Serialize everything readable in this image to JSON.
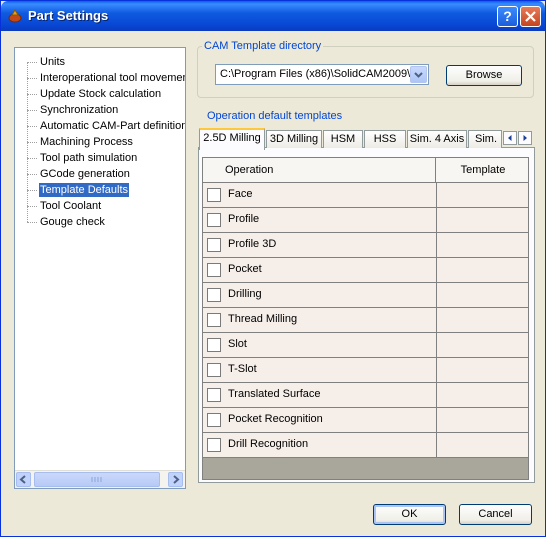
{
  "window": {
    "title": "Part Settings",
    "help_label": "?"
  },
  "tree": {
    "items": [
      {
        "label": "Units",
        "selected": false
      },
      {
        "label": "Interoperational tool movemen",
        "selected": false
      },
      {
        "label": "Update Stock calculation",
        "selected": false
      },
      {
        "label": "Synchronization",
        "selected": false
      },
      {
        "label": "Automatic CAM-Part definition",
        "selected": false
      },
      {
        "label": "Machining Process",
        "selected": false
      },
      {
        "label": "Tool path simulation",
        "selected": false
      },
      {
        "label": "GCode generation",
        "selected": false
      },
      {
        "label": "Template Defaults",
        "selected": true
      },
      {
        "label": "Tool Coolant",
        "selected": false
      },
      {
        "label": "Gouge check",
        "selected": false
      }
    ]
  },
  "cam_dir": {
    "group_title": "CAM Template directory",
    "path_value": "C:\\Program Files (x86)\\SolidCAM2009\\",
    "browse_label": "Browse"
  },
  "op_templates": {
    "group_title": "Operation default templates",
    "tabs": [
      "2.5D Milling",
      "3D Milling",
      "HSM",
      "HSS",
      "Sim. 4 Axis",
      "Sim."
    ],
    "active_tab": "2.5D Milling",
    "columns": {
      "operation": "Operation",
      "template": "Template"
    },
    "rows": [
      {
        "operation": "Face",
        "template": "",
        "checked": false
      },
      {
        "operation": "Profile",
        "template": "",
        "checked": false
      },
      {
        "operation": "Profile 3D",
        "template": "",
        "checked": false
      },
      {
        "operation": "Pocket",
        "template": "",
        "checked": false
      },
      {
        "operation": "Drilling",
        "template": "",
        "checked": false
      },
      {
        "operation": "Thread Milling",
        "template": "",
        "checked": false
      },
      {
        "operation": "Slot",
        "template": "",
        "checked": false
      },
      {
        "operation": "T-Slot",
        "template": "",
        "checked": false
      },
      {
        "operation": "Translated Surface",
        "template": "",
        "checked": false
      },
      {
        "operation": "Pocket Recognition",
        "template": "",
        "checked": false
      },
      {
        "operation": "Drill Recognition",
        "template": "",
        "checked": false
      }
    ]
  },
  "footer": {
    "ok_label": "OK",
    "cancel_label": "Cancel"
  },
  "colors": {
    "titlebar": "#0a5ee8",
    "selection": "#316ac5",
    "group_title": "#0046d5",
    "active_tab_highlight": "#ffc83c"
  }
}
